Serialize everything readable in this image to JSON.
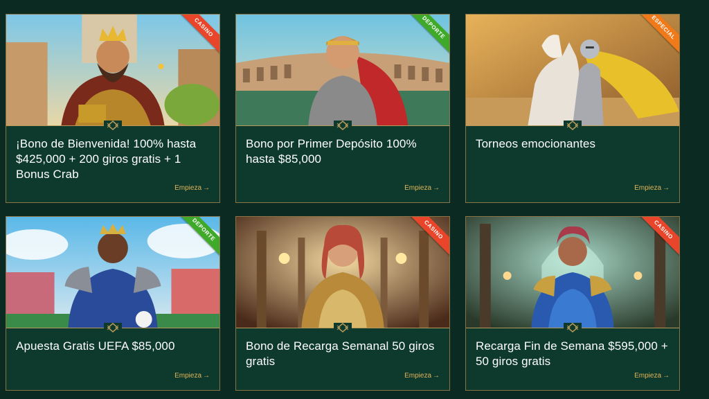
{
  "colors": {
    "background": "#0b2a22",
    "card_bg": "#0d3a2d",
    "border": "#8a7445",
    "cta": "#e2b45a",
    "ribbon_casino": "#e8452a",
    "ribbon_deporte": "#3faa2a",
    "ribbon_especial": "#f07a1a"
  },
  "cards": [
    {
      "ribbon": "CASINO",
      "ribbon_color": "#e8452a",
      "title": "¡Bono de Bienvenida! 100% hasta $425,000 + 200 giros gratis + 1 Bonus Crab",
      "cta": "Empieza",
      "image": "king-character-illustration"
    },
    {
      "ribbon": "DEPORTE",
      "ribbon_color": "#3faa2a",
      "title": "Bono por Primer Depósito 100% hasta $85,000",
      "cta": "Empieza",
      "image": "gladiator-character-illustration"
    },
    {
      "ribbon": "ESPECIAL",
      "ribbon_color": "#f07a1a",
      "title": "Torneos emocionantes",
      "cta": "Empieza",
      "image": "knight-on-horse-illustration"
    },
    {
      "ribbon": "DEPORTE",
      "ribbon_color": "#3faa2a",
      "title": "Apuesta Gratis UEFA $85,000",
      "cta": "Empieza",
      "image": "armored-footballer-illustration"
    },
    {
      "ribbon": "CASINO",
      "ribbon_color": "#e8452a",
      "title": "Bono de Recarga Semanal 50 giros gratis",
      "cta": "Empieza",
      "image": "warrior-woman-gold-armor-illustration"
    },
    {
      "ribbon": "CASINO",
      "ribbon_color": "#e8452a",
      "title": "Recarga Fin de Semana $595,000 + 50 giros gratis",
      "cta": "Empieza",
      "image": "warrior-woman-blue-armor-illustration"
    }
  ]
}
